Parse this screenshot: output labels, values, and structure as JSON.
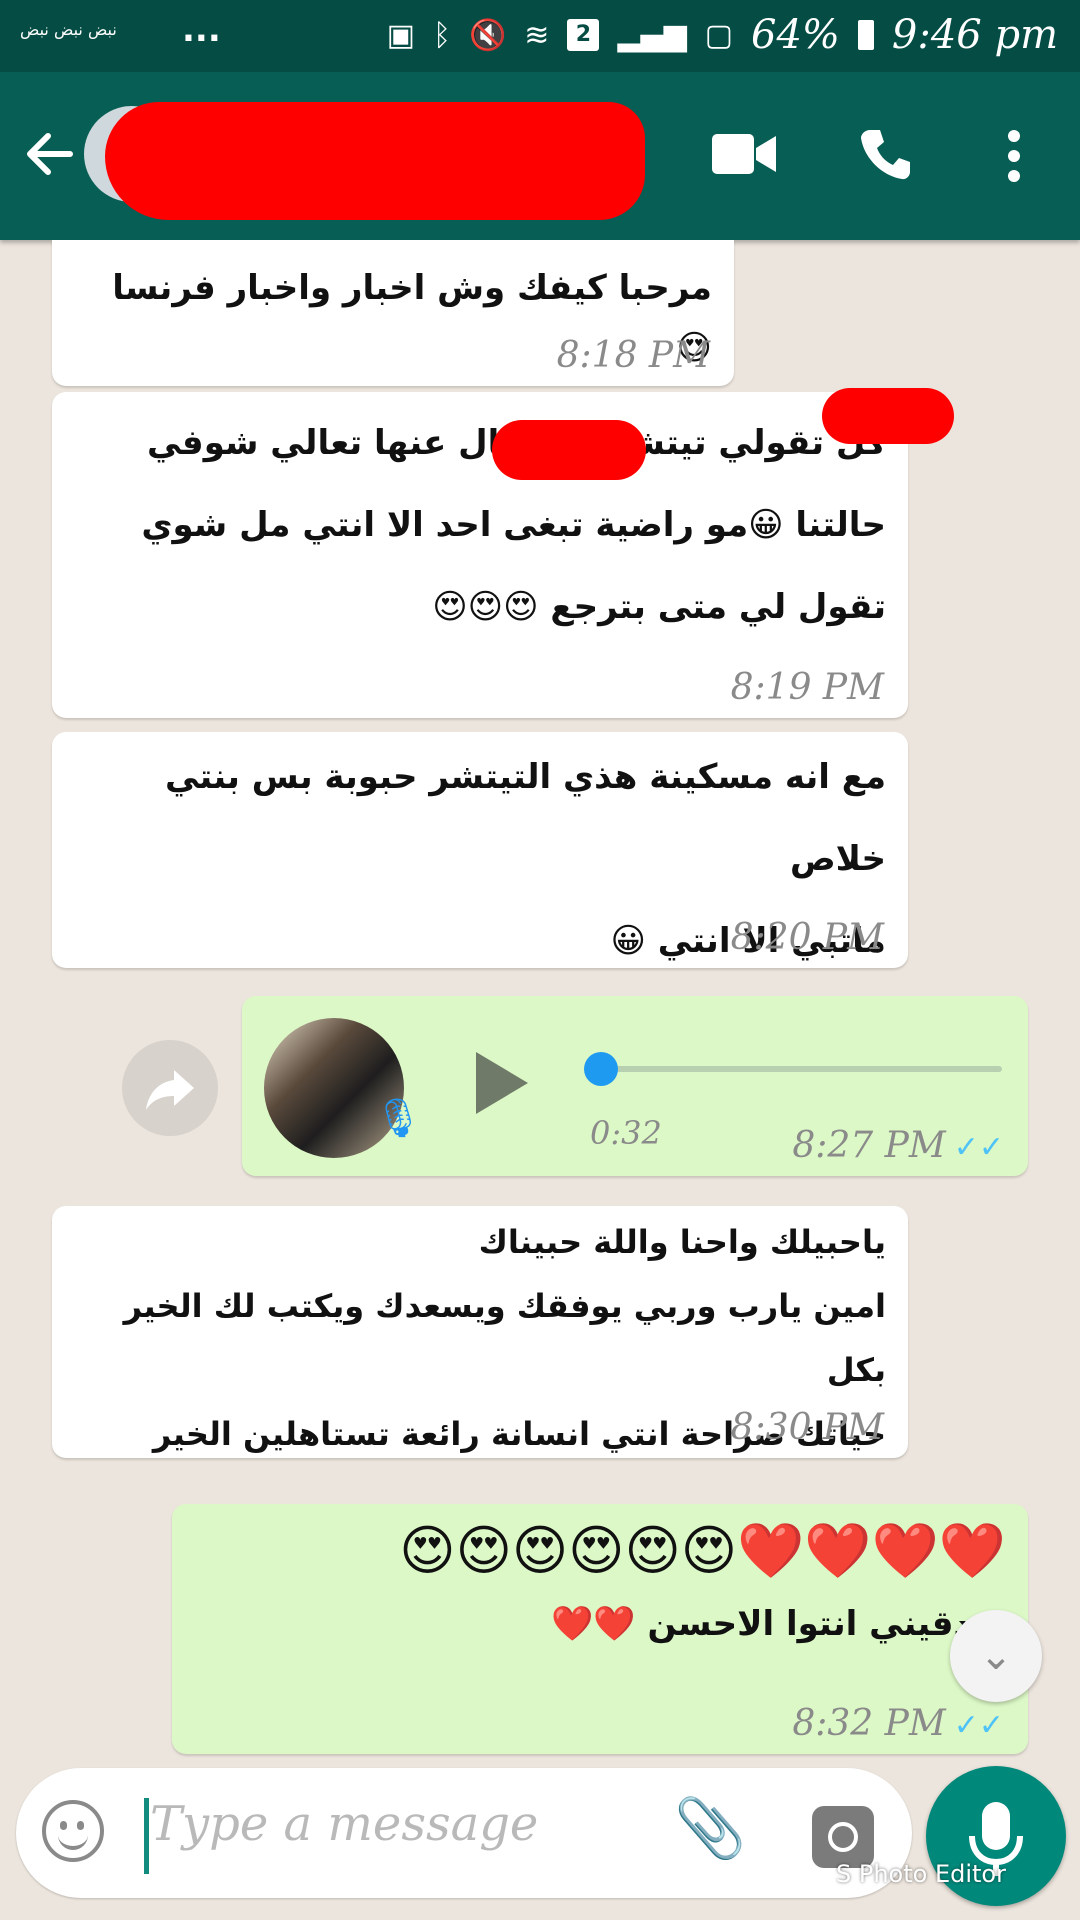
{
  "status_bar": {
    "notification_text": "نبض نبض نبض",
    "overflow_dots": "...",
    "sim_badge": "2",
    "battery_percent": "64%",
    "time": "9:46 pm"
  },
  "header": {
    "back_icon": "arrow-left-icon",
    "video_icon": "video-camera-icon",
    "call_icon": "phone-icon",
    "menu_icon": "more-vertical-icon"
  },
  "messages": [
    {
      "direction": "in",
      "lines": [
        "مرحبا كيفك وش اخبار واخبار فرنسا 😍"
      ],
      "time": "8:18 PM"
    },
    {
      "direction": "in",
      "lines": [
        "كل تقولي تيتشر ... تسال عنها تعالي شوفي",
        "حالتنا 😀مو راضية تبغى احد الا انتي مل شوي",
        "تقول لي متى بترجع 😍😍😍"
      ],
      "time": "8:19 PM"
    },
    {
      "direction": "in",
      "lines": [
        "مع انه مسكينة هذي التيتشر حبوبة بس بنتي خلاص",
        "ماتبي الا انتي 😀"
      ],
      "time": "8:20 PM"
    },
    {
      "direction": "out",
      "type": "voice",
      "duration": "0:32",
      "progress": 0,
      "time": "8:27 PM",
      "ticks": "✓✓"
    },
    {
      "direction": "in",
      "lines": [
        "ياحبيلك واحنا واللة حبيناك",
        "امين يارب وربي يوفقك ويسعدك ويكتب لك الخير بكل",
        "حياتك صراحة انتي انسانة رائعة تستاهلين الخير"
      ],
      "time": "8:30 PM"
    },
    {
      "direction": "out",
      "lines": [
        "❤️❤️❤️❤️😍😍😍😍😍😍",
        "صدقيني انتوا الاحسن ❤️❤️"
      ],
      "time": "8:32 PM",
      "ticks": "✓✓"
    }
  ],
  "input": {
    "placeholder": "Type a message",
    "emoji_icon": "smiley-icon",
    "attach_icon": "paperclip-icon",
    "camera_icon": "camera-icon",
    "mic_icon": "microphone-icon"
  },
  "watermark": "S Photo Editor",
  "colors": {
    "header": "#075e54",
    "status": "#054d44",
    "outgoing": "#dcf8c6",
    "incoming": "#ffffff",
    "accent": "#00897b"
  }
}
